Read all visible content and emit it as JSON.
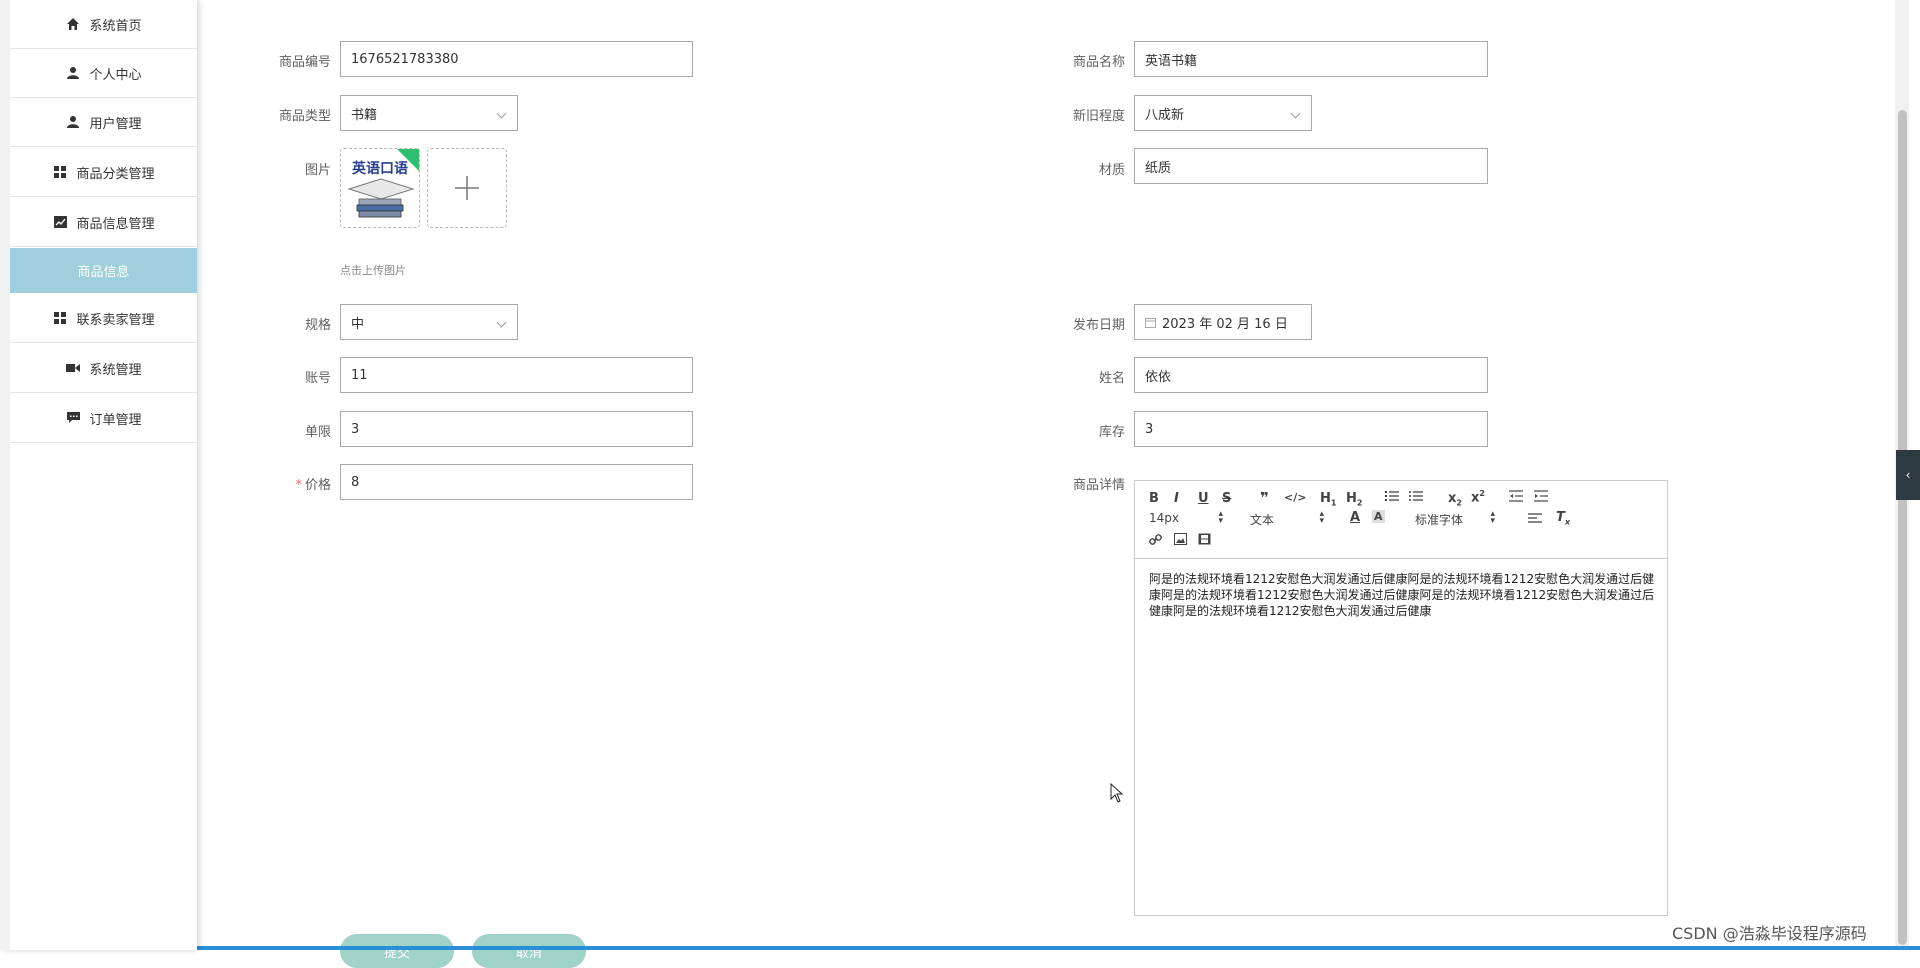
{
  "sidebar": {
    "items": [
      {
        "label": "系统首页",
        "icon": "home-icon"
      },
      {
        "label": "个人中心",
        "icon": "user-icon"
      },
      {
        "label": "用户管理",
        "icon": "user-icon"
      },
      {
        "label": "商品分类管理",
        "icon": "grid-icon"
      },
      {
        "label": "商品信息管理",
        "icon": "chart-icon"
      },
      {
        "label": "商品信息",
        "icon": ""
      },
      {
        "label": "联系卖家管理",
        "icon": "grid-icon"
      },
      {
        "label": "系统管理",
        "icon": "video-icon"
      },
      {
        "label": "订单管理",
        "icon": "chat-icon"
      }
    ]
  },
  "form": {
    "product_no": {
      "label": "商品编号",
      "value": "1676521783380"
    },
    "product_name": {
      "label": "商品名称",
      "value": "英语书籍"
    },
    "product_type": {
      "label": "商品类型",
      "value": "书籍"
    },
    "condition": {
      "label": "新旧程度",
      "value": "八成新"
    },
    "image": {
      "label": "图片",
      "thumb_text": "英语口语",
      "hint": "点击上传图片"
    },
    "material": {
      "label": "材质",
      "value": "纸质"
    },
    "spec": {
      "label": "规格",
      "value": "中"
    },
    "publish_date": {
      "label": "发布日期",
      "value": "2023 年 02 月 16 日"
    },
    "account": {
      "label": "账号",
      "value": "11"
    },
    "name": {
      "label": "姓名",
      "value": "依依"
    },
    "limit": {
      "label": "单限",
      "value": "3"
    },
    "stock": {
      "label": "库存",
      "value": "3"
    },
    "price": {
      "label": "价格",
      "required_mark": "*",
      "value": "8"
    },
    "detail": {
      "label": "商品详情"
    }
  },
  "editor": {
    "font_size": "14px",
    "text_type": "文本",
    "font_family": "标准字体",
    "content": "阿是的法规环境看1212安慰色大润发通过后健康阿是的法规环境看1212安慰色大润发通过后健康阿是的法规环境看1212安慰色大润发通过后健康阿是的法规环境看1212安慰色大润发通过后健康阿是的法规环境看1212安慰色大润发通过后健康"
  },
  "buttons": {
    "submit": "提交",
    "cancel": "取消"
  },
  "watermark": "CSDN @浩淼毕设程序源码",
  "colors": {
    "sidebar_active": "#9fcfdc",
    "button": "#9fd2c8",
    "required": "#f56c6c"
  }
}
